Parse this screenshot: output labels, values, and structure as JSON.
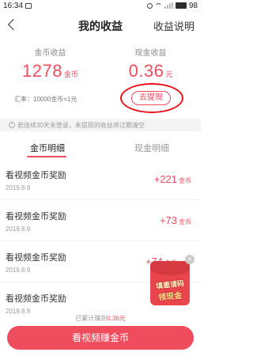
{
  "status_bar": {
    "time": "16:34",
    "battery": "98"
  },
  "header": {
    "title": "我的收益",
    "action": "收益说明"
  },
  "summary": {
    "coin_label": "金币收益",
    "coin_value": "1278",
    "coin_unit": "金币",
    "cash_label": "现金收益",
    "cash_value": "0.36",
    "cash_unit": "元",
    "rate_text": "汇率：10000金币=1元",
    "withdraw_label": "去提现"
  },
  "notice": "若连续30天未登录，未提现的收益将过期清空",
  "tabs": [
    {
      "label": "金币明细",
      "active": true
    },
    {
      "label": "现金明细",
      "active": false
    }
  ],
  "records": [
    {
      "title": "看视频金币奖励",
      "date": "2019.8.9",
      "amount": "+221",
      "unit": "金币"
    },
    {
      "title": "看视频金币奖励",
      "date": "2019.8.9",
      "amount": "+73",
      "unit": "金币"
    },
    {
      "title": "看视频金币奖励",
      "date": "2019.8.9",
      "amount": "+74",
      "unit": "金币"
    },
    {
      "title": "看视频金币奖励",
      "date": "2019.8.9",
      "amount": "",
      "unit": ""
    }
  ],
  "promo": {
    "line1": "填邀请码",
    "line2": "领现金",
    "close": "×"
  },
  "footer": {
    "note_prefix": "已累计赚到",
    "note_value": "0.36元"
  },
  "cta": {
    "label": "看视频赚金币"
  },
  "colors": {
    "accent": "#ef4d5e",
    "annotation": "#e8101b"
  }
}
